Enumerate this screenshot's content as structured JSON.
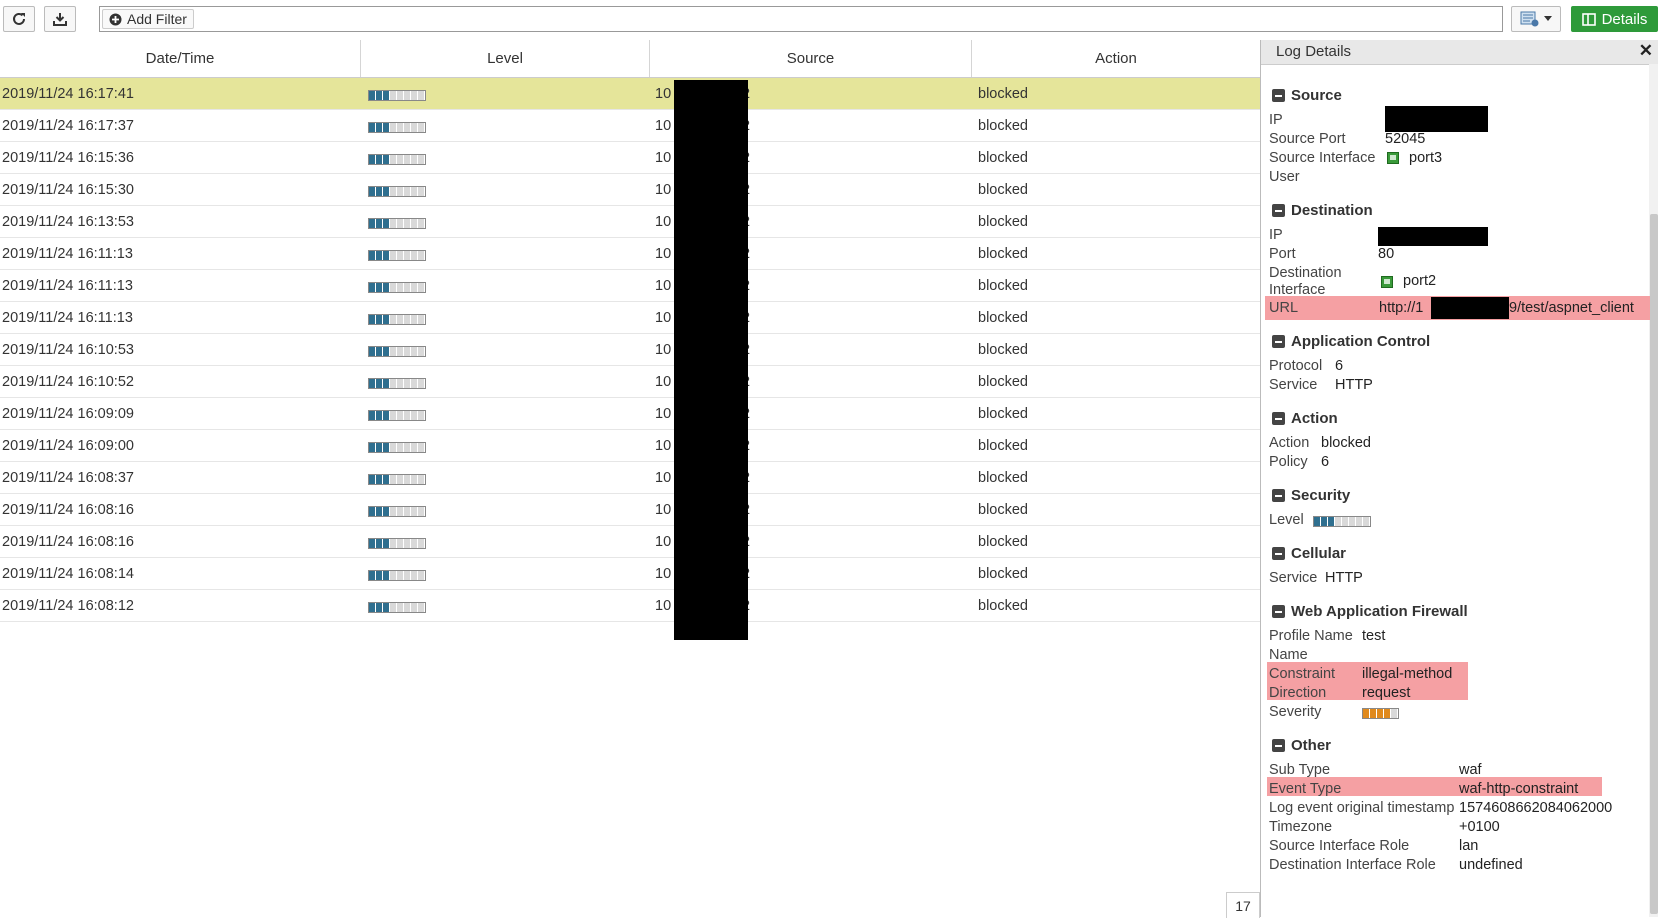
{
  "toolbar": {
    "add_filter_label": "Add Filter",
    "details_label": "Details"
  },
  "colors": {
    "selected_row": "#e5e59a",
    "level_filled": "#2f6f8f",
    "level_empty": "#d9d9d9",
    "severity_filled": "#e08a1e",
    "highlight": "#f5a0a3",
    "details_button": "#2e9a3a"
  },
  "table": {
    "columns": [
      "Date/Time",
      "Level",
      "Source",
      "Action"
    ],
    "rows": [
      {
        "datetime": "2019/11/24 16:17:41",
        "level": 3,
        "source_prefix": "10",
        "source_suffix": "2",
        "action": "blocked",
        "selected": true
      },
      {
        "datetime": "2019/11/24 16:17:37",
        "level": 3,
        "source_prefix": "10",
        "source_suffix": "2",
        "action": "blocked"
      },
      {
        "datetime": "2019/11/24 16:15:36",
        "level": 3,
        "source_prefix": "10",
        "source_suffix": "2",
        "action": "blocked"
      },
      {
        "datetime": "2019/11/24 16:15:30",
        "level": 3,
        "source_prefix": "10",
        "source_suffix": "2",
        "action": "blocked"
      },
      {
        "datetime": "2019/11/24 16:13:53",
        "level": 3,
        "source_prefix": "10",
        "source_suffix": "2",
        "action": "blocked"
      },
      {
        "datetime": "2019/11/24 16:11:13",
        "level": 3,
        "source_prefix": "10",
        "source_suffix": "2",
        "action": "blocked"
      },
      {
        "datetime": "2019/11/24 16:11:13",
        "level": 3,
        "source_prefix": "10",
        "source_suffix": "2",
        "action": "blocked"
      },
      {
        "datetime": "2019/11/24 16:11:13",
        "level": 3,
        "source_prefix": "10",
        "source_suffix": "2",
        "action": "blocked"
      },
      {
        "datetime": "2019/11/24 16:10:53",
        "level": 3,
        "source_prefix": "10",
        "source_suffix": "2",
        "action": "blocked"
      },
      {
        "datetime": "2019/11/24 16:10:52",
        "level": 3,
        "source_prefix": "10",
        "source_suffix": "2",
        "action": "blocked"
      },
      {
        "datetime": "2019/11/24 16:09:09",
        "level": 3,
        "source_prefix": "10",
        "source_suffix": "2",
        "action": "blocked"
      },
      {
        "datetime": "2019/11/24 16:09:00",
        "level": 3,
        "source_prefix": "10",
        "source_suffix": "2",
        "action": "blocked"
      },
      {
        "datetime": "2019/11/24 16:08:37",
        "level": 3,
        "source_prefix": "10",
        "source_suffix": "2",
        "action": "blocked"
      },
      {
        "datetime": "2019/11/24 16:08:16",
        "level": 3,
        "source_prefix": "10",
        "source_suffix": "2",
        "action": "blocked"
      },
      {
        "datetime": "2019/11/24 16:08:16",
        "level": 3,
        "source_prefix": "10",
        "source_suffix": "2",
        "action": "blocked"
      },
      {
        "datetime": "2019/11/24 16:08:14",
        "level": 3,
        "source_prefix": "10",
        "source_suffix": "2",
        "action": "blocked"
      },
      {
        "datetime": "2019/11/24 16:08:12",
        "level": 3,
        "source_prefix": "10",
        "source_suffix": "2",
        "action": "blocked"
      }
    ],
    "level_max": 8
  },
  "details": {
    "title": "Log Details",
    "source": {
      "heading": "Source",
      "ip_label": "IP",
      "port_label": "Source Port",
      "port": "52045",
      "interface_label": "Source Interface",
      "interface": "port3",
      "user_label": "User"
    },
    "destination": {
      "heading": "Destination",
      "ip_label": "IP",
      "port_label": "Port",
      "port": "80",
      "interface_label_1": "Destination",
      "interface_label_2": "Interface",
      "interface": "port2",
      "url_label": "URL",
      "url_prefix": "http://1",
      "url_suffix": "9/test/aspnet_client"
    },
    "app_control": {
      "heading": "Application Control",
      "protocol_label": "Protocol",
      "protocol": "6",
      "service_label": "Service",
      "service": "HTTP"
    },
    "action": {
      "heading": "Action",
      "action_label": "Action",
      "action": "blocked",
      "policy_label": "Policy",
      "policy": "6"
    },
    "security": {
      "heading": "Security",
      "level_label": "Level",
      "level": 3
    },
    "cellular": {
      "heading": "Cellular",
      "service_label": "Service",
      "service": "HTTP"
    },
    "waf": {
      "heading": "Web Application Firewall",
      "profile_label": "Profile Name",
      "profile": "test",
      "name_label": "Name",
      "constraint_label": "Constraint",
      "constraint": "illegal-method",
      "direction_label": "Direction",
      "direction": "request",
      "severity_label": "Severity",
      "severity": 4,
      "severity_max": 5
    },
    "other": {
      "heading": "Other",
      "subtype_label": "Sub Type",
      "subtype": "waf",
      "eventtype_label": "Event Type",
      "eventtype": "waf-http-constraint",
      "ts_label": "Log event original timestamp",
      "ts": "1574608662084062000",
      "tz_label": "Timezone",
      "tz": "+0100",
      "sir_label": "Source Interface Role",
      "sir": "lan",
      "dir_label": "Destination Interface Role",
      "dir": "undefined"
    }
  },
  "pager": {
    "value": "17"
  }
}
